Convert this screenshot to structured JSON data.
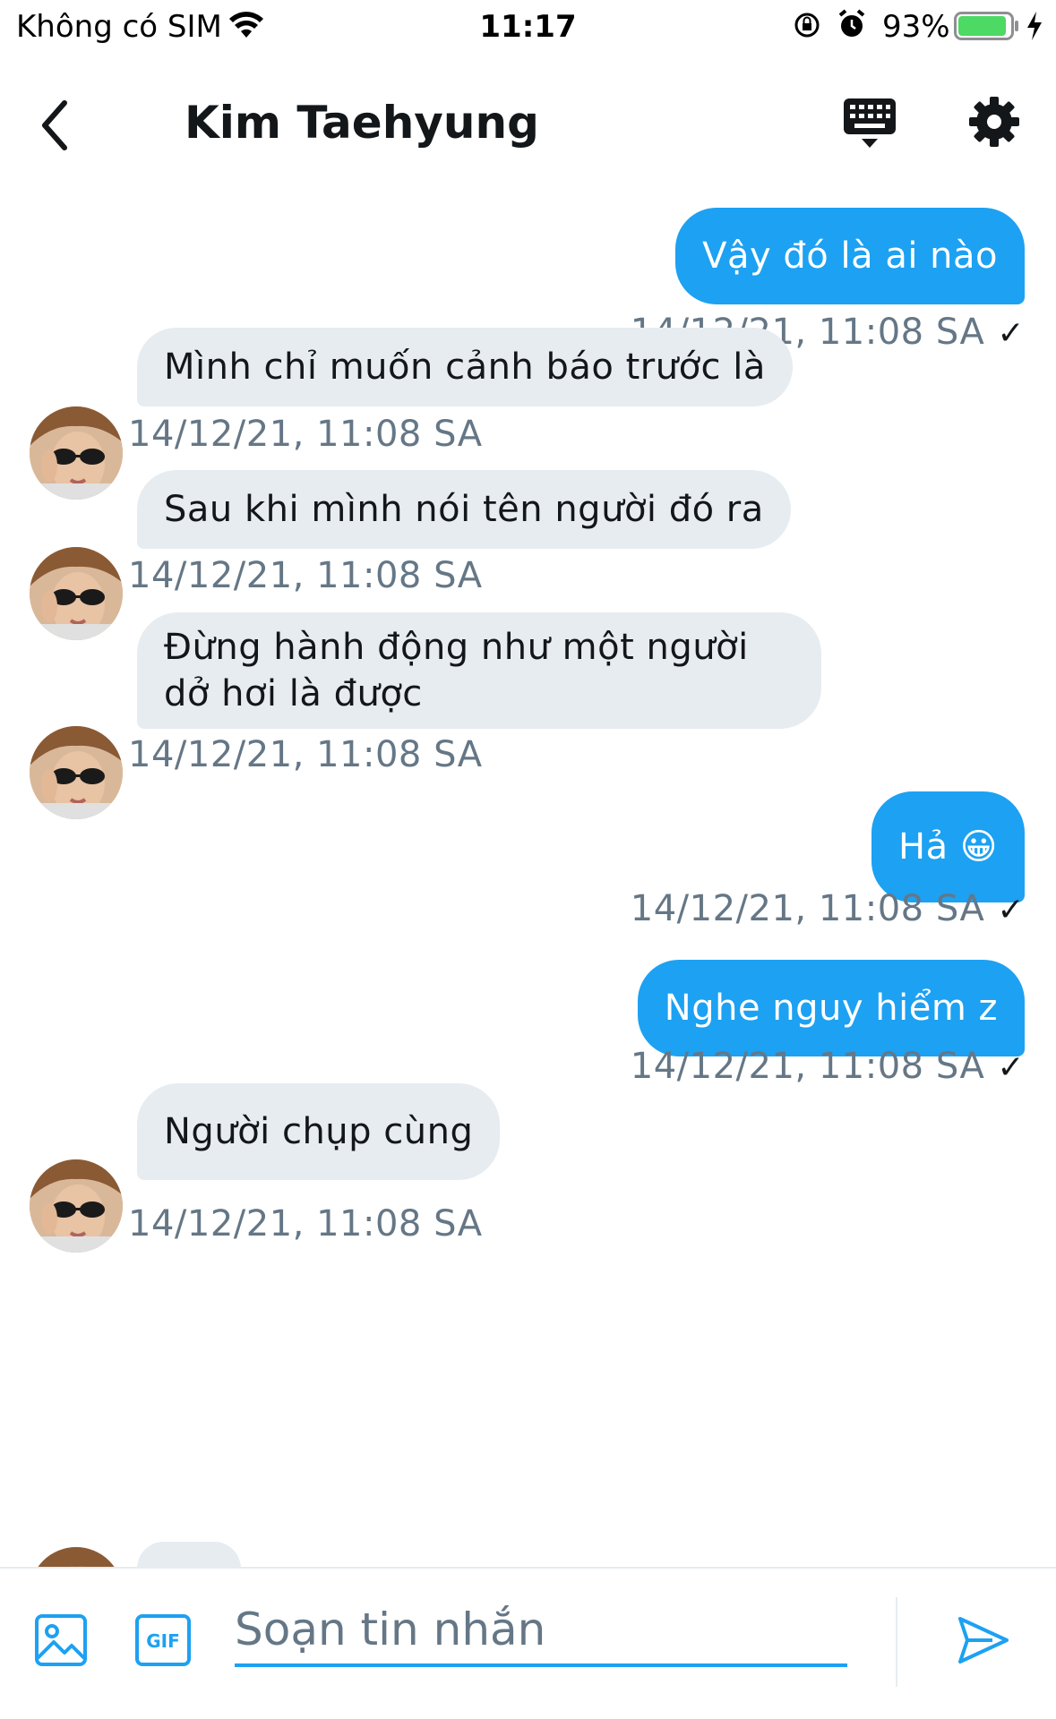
{
  "status_bar": {
    "carrier": "Không có SIM",
    "time": "11:17",
    "battery": "93%",
    "battery_level": 0.93,
    "icons": [
      "wifi-icon",
      "rotation-lock-icon",
      "alarm-icon",
      "battery-icon",
      "charging-bolt-icon"
    ]
  },
  "header": {
    "title": "Kim Taehyung",
    "icons": [
      "back-chevron-icon",
      "keyboard-icon",
      "gear-icon"
    ]
  },
  "messages": [
    {
      "direction": "out",
      "text": "Vậy đó là ai nào",
      "time": "14/12/21, 11:08 SA",
      "check": "✓"
    },
    {
      "direction": "in",
      "text": "Mình chỉ muốn cảnh báo trước là",
      "time": "14/12/21, 11:08 SA"
    },
    {
      "direction": "in",
      "text": "Sau khi mình nói tên người đó ra",
      "time": "14/12/21, 11:08 SA"
    },
    {
      "direction": "in",
      "text": "Đừng hành động như một người dở hơi là được",
      "time": "14/12/21, 11:08 SA"
    },
    {
      "direction": "out",
      "text": "Hả 😀",
      "time": "14/12/21, 11:08 SA",
      "check": "✓"
    },
    {
      "direction": "out",
      "text": "Nghe nguy hiểm z",
      "time": "14/12/21, 11:08 SA",
      "check": "✓"
    },
    {
      "direction": "in",
      "text": "Người chụp cùng",
      "time": "14/12/21, 11:08 SA"
    }
  ],
  "composer": {
    "placeholder": "Soạn tin nhắn",
    "icons": [
      "image-icon",
      "gif-icon",
      "send-icon"
    ],
    "gif_label": "GIF"
  },
  "colors": {
    "accent": "#1da1f2",
    "incoming_bubble": "#e6ecf0",
    "timestamp": "#657786",
    "battery_fill": "#4cd964"
  }
}
